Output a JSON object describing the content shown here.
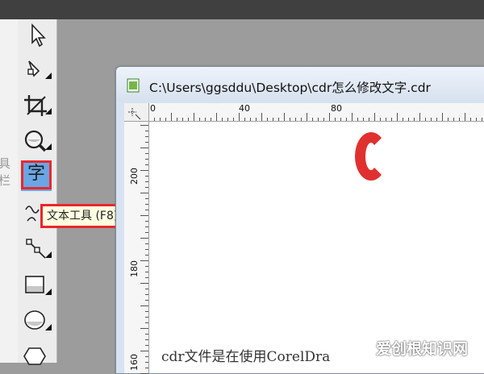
{
  "document": {
    "title": "C:\\Users\\ggsddu\\Desktop\\cdr怎么修改文字.cdr",
    "body_text_visible": "cdr文件是在使用CorelDra"
  },
  "left_hint": {
    "text": "具栏"
  },
  "toolbox": {
    "tools": [
      {
        "name": "pick-tool",
        "icon": "arrow-pointer-icon"
      },
      {
        "name": "shape-tool",
        "icon": "shape-edit-icon"
      },
      {
        "name": "crop-tool",
        "icon": "crop-icon"
      },
      {
        "name": "zoom-tool",
        "icon": "magnifier-icon"
      },
      {
        "name": "text-tool",
        "icon": "text-icon",
        "glyph": "字",
        "active": true
      },
      {
        "name": "freehand-tool",
        "icon": "freehand-icon"
      },
      {
        "name": "connector-tool",
        "icon": "connector-icon"
      },
      {
        "name": "rectangle-tool",
        "icon": "rectangle-icon"
      },
      {
        "name": "ellipse-tool",
        "icon": "ellipse-icon"
      },
      {
        "name": "polygon-tool",
        "icon": "polygon-icon"
      }
    ]
  },
  "tooltip": {
    "text": "文本工具 (F8)"
  },
  "rulers": {
    "horizontal_labels": [
      "0",
      "40",
      "80"
    ],
    "vertical_labels": [
      "200",
      "180",
      "160"
    ]
  },
  "watermark": {
    "text": "爱创根知识网"
  },
  "colors": {
    "highlight": "#e8282c",
    "active_tool": "#6aa6e6",
    "accent_red": "#e03030"
  }
}
